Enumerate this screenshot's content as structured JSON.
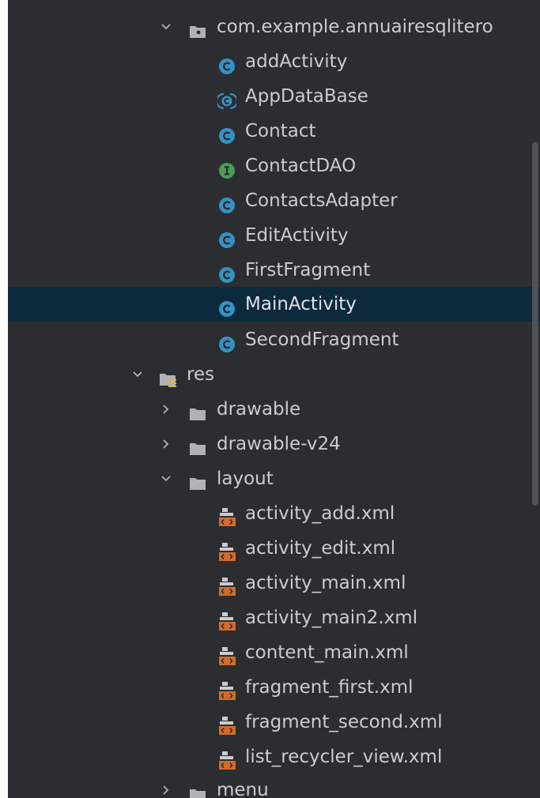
{
  "colors": {
    "panel_bg": "#2b2d30",
    "selection_bg": "#0d293e",
    "text": "#c9ccd1",
    "class_icon": "#3592c4",
    "interface_icon": "#499c54",
    "folder": "#aeb3b9",
    "layout_file": "#d56a2a"
  },
  "tree": {
    "package": {
      "label": "com.example.annuairesqlitero",
      "icon": "package-icon"
    },
    "classes": [
      {
        "label": "addActivity",
        "icon": "class-icon"
      },
      {
        "label": "AppDataBase",
        "icon": "abstract-class-icon"
      },
      {
        "label": "Contact",
        "icon": "class-icon"
      },
      {
        "label": "ContactDAO",
        "icon": "interface-icon",
        "letter": "I"
      },
      {
        "label": "ContactsAdapter",
        "icon": "class-icon"
      },
      {
        "label": "EditActivity",
        "icon": "class-icon"
      },
      {
        "label": "FirstFragment",
        "icon": "class-icon"
      },
      {
        "label": "MainActivity",
        "icon": "class-icon",
        "selected": true
      },
      {
        "label": "SecondFragment",
        "icon": "class-icon"
      }
    ],
    "res": {
      "label": "res",
      "icon": "resource-folder-icon"
    },
    "res_folders": [
      {
        "label": "drawable",
        "icon": "folder-icon",
        "expanded": false
      },
      {
        "label": "drawable-v24",
        "icon": "folder-icon",
        "expanded": false
      },
      {
        "label": "layout",
        "icon": "folder-icon",
        "expanded": true
      }
    ],
    "layout_files": [
      {
        "label": "activity_add.xml",
        "icon": "layout-xml-icon"
      },
      {
        "label": "activity_edit.xml",
        "icon": "layout-xml-icon"
      },
      {
        "label": "activity_main.xml",
        "icon": "layout-xml-icon"
      },
      {
        "label": "activity_main2.xml",
        "icon": "layout-xml-icon"
      },
      {
        "label": "content_main.xml",
        "icon": "layout-xml-icon"
      },
      {
        "label": "fragment_first.xml",
        "icon": "layout-xml-icon"
      },
      {
        "label": "fragment_second.xml",
        "icon": "layout-xml-icon"
      },
      {
        "label": "list_recycler_view.xml",
        "icon": "layout-xml-icon"
      }
    ],
    "menu": {
      "label": "menu",
      "icon": "folder-icon",
      "expanded": false
    }
  }
}
